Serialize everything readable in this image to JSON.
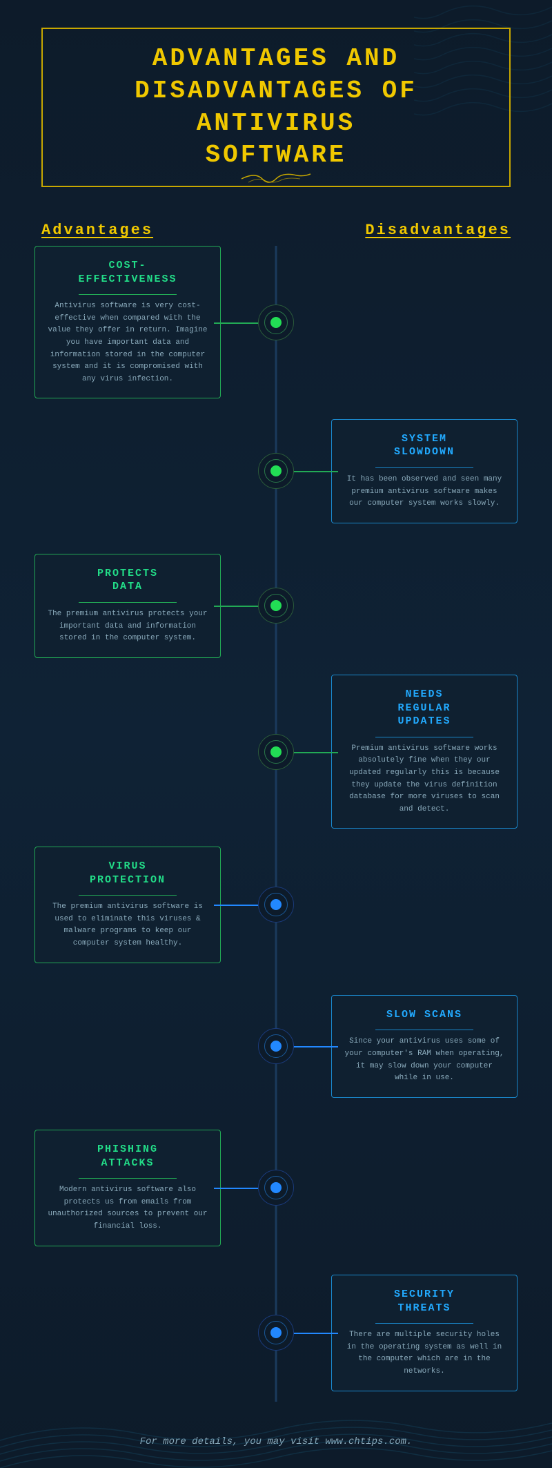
{
  "header": {
    "title": "ADVANTAGES AND\nDISADVANTAGES OF\nANTIVIRUS\nSOFTWARE"
  },
  "sections": {
    "advantages_label": "Advantages",
    "disadvantages_label": "Disadvantages"
  },
  "items": [
    {
      "id": "cost-effectiveness",
      "side": "left",
      "title": "COST-\nEFFECTIVENESS",
      "title_color": "green",
      "text": "Antivirus software is very cost-effective when compared with the value they offer in return. Imagine you have important data and information stored in the computer system and it is compromised with any virus infection.",
      "node_color": "green"
    },
    {
      "id": "system-slowdown",
      "side": "right",
      "title": "SYSTEM\nSLOWDOWN",
      "title_color": "blue",
      "text": "It has been observed and seen many premium antivirus software makes our computer system works slowly.",
      "node_color": "green"
    },
    {
      "id": "protects-data",
      "side": "left",
      "title": "PROTECTS\nDATA",
      "title_color": "green",
      "text": "The premium antivirus protects your important data and information stored in the computer system.",
      "node_color": "green"
    },
    {
      "id": "needs-regular-updates",
      "side": "right",
      "title": "NEEDS\nREGULAR\nUPDATES",
      "title_color": "blue",
      "text": "Premium antivirus software works absolutely fine when they our updated regularly this is because they update the virus definition database for more viruses to scan and detect.",
      "node_color": "green"
    },
    {
      "id": "virus-protection",
      "side": "left",
      "title": "VIRUS\nPROTECTION",
      "title_color": "green",
      "text": "The premium antivirus software is used to eliminate this viruses & malware programs to keep our computer system healthy.",
      "node_color": "blue"
    },
    {
      "id": "slow-scans",
      "side": "right",
      "title": "SLOW SCANS",
      "title_color": "blue",
      "text": "Since your antivirus uses some of your computer's RAM when operating, it may slow down your computer while in use.",
      "node_color": "blue"
    },
    {
      "id": "phishing-attacks",
      "side": "left",
      "title": "PHISHING\nATTACKS",
      "title_color": "green",
      "text": "Modern antivirus software also protects us from emails from unauthorized sources to prevent our financial loss.",
      "node_color": "blue"
    },
    {
      "id": "security-threats",
      "side": "right",
      "title": "SECURITY\nTHREATS",
      "title_color": "blue",
      "text": "There are multiple security holes in the operating system as well in the computer which are in the networks.",
      "node_color": "blue"
    }
  ],
  "footer": {
    "text": "For more details, you may visit www.chtips.com."
  }
}
